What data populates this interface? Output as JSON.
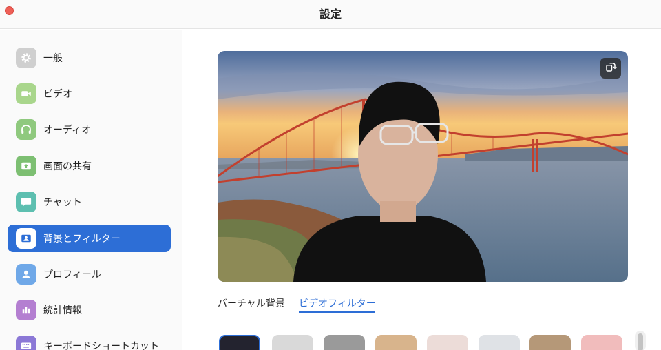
{
  "window": {
    "title": "設定"
  },
  "sidebar": {
    "items": [
      {
        "label": "一般",
        "icon": "gear-icon",
        "color": "#cfcfcf",
        "active": false
      },
      {
        "label": "ビデオ",
        "icon": "camera-icon",
        "color": "#a9d68c",
        "active": false
      },
      {
        "label": "オーディオ",
        "icon": "headphones-icon",
        "color": "#8fc97e",
        "active": false
      },
      {
        "label": "画面の共有",
        "icon": "share-screen-icon",
        "color": "#7dbf72",
        "active": false
      },
      {
        "label": "チャット",
        "icon": "chat-icon",
        "color": "#5dbfb0",
        "active": false
      },
      {
        "label": "背景とフィルター",
        "icon": "background-icon",
        "color": "#2d6ed6",
        "active": true
      },
      {
        "label": "プロフィール",
        "icon": "profile-icon",
        "color": "#6fa8e8",
        "active": false
      },
      {
        "label": "統計情報",
        "icon": "stats-icon",
        "color": "#b47fd1",
        "active": false
      },
      {
        "label": "キーボードショートカット",
        "icon": "keyboard-icon",
        "color": "#8b78d6",
        "active": false
      }
    ]
  },
  "preview": {
    "rotate_icon": "rotate-camera-icon"
  },
  "tabs": [
    {
      "label": "バーチャル背景",
      "active": false
    },
    {
      "label": "ビデオフィルター",
      "active": true
    }
  ],
  "filters": [
    {
      "color": "#23232f",
      "selected": true
    },
    {
      "color": "#d9d9d9",
      "selected": false
    },
    {
      "color": "#9a9a9a",
      "selected": false
    },
    {
      "color": "#d8b48c",
      "selected": false
    },
    {
      "color": "#ecdcd8",
      "selected": false
    },
    {
      "color": "#dfe2e6",
      "selected": false
    },
    {
      "color": "#b59878",
      "selected": false
    },
    {
      "color": "#f1bcbc",
      "selected": false
    }
  ],
  "colors": {
    "accent": "#2d6ed6",
    "close": "#ee5f57"
  }
}
